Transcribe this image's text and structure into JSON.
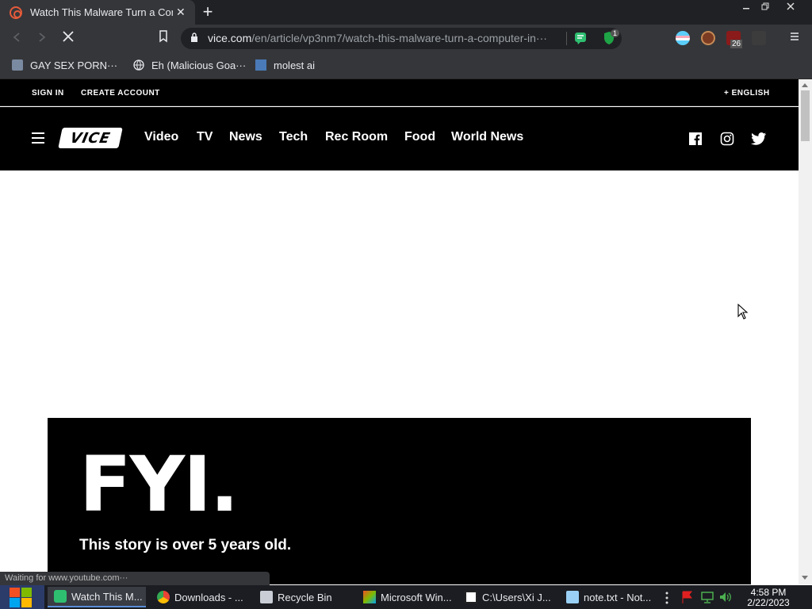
{
  "browser": {
    "tab_title": "Watch This Malware Turn a Com",
    "tab_close": "✕",
    "new_tab": "+",
    "url_domain": "vice.com",
    "url_path": "/en/article/vp3nm7/watch-this-malware-turn-a-computer-in···",
    "extension_badge": "1",
    "ext_count": "26",
    "window_controls": {
      "minimize": "🗕",
      "restore": "🗗",
      "close": "✕"
    }
  },
  "bookmarks": [
    {
      "label": "GAY SEX PORN···"
    },
    {
      "label": "Eh (Malicious Goa···"
    },
    {
      "label": "molest ai"
    }
  ],
  "site": {
    "top_links": {
      "sign_in": "SIGN IN",
      "create_account": "CREATE ACCOUNT",
      "language": "+ ENGLISH"
    },
    "logo": "VICE",
    "nav": [
      "Video",
      "TV",
      "News",
      "Tech",
      "Rec Room",
      "Food",
      "World News"
    ],
    "social": [
      "facebook-icon",
      "instagram-icon",
      "twitter-icon"
    ]
  },
  "article": {
    "fyi_heading": "FYI.",
    "fyi_sub": "This story is over 5 years old."
  },
  "status_text": "Waiting for www.youtube.com···",
  "taskbar": {
    "items": [
      {
        "label": "Watch This M..."
      },
      {
        "label": "Downloads - ..."
      },
      {
        "label": "Recycle Bin"
      },
      {
        "label": "Microsoft Win..."
      },
      {
        "label": "C:\\Users\\Xi J..."
      },
      {
        "label": "note.txt - Not..."
      }
    ],
    "time": "4:58 PM",
    "date": "2/22/2023"
  },
  "colors": {
    "chrome_dark": "#202124",
    "chrome_toolbar": "#35363a",
    "vice_black": "#000000",
    "taskbar": "#1b1d22"
  }
}
